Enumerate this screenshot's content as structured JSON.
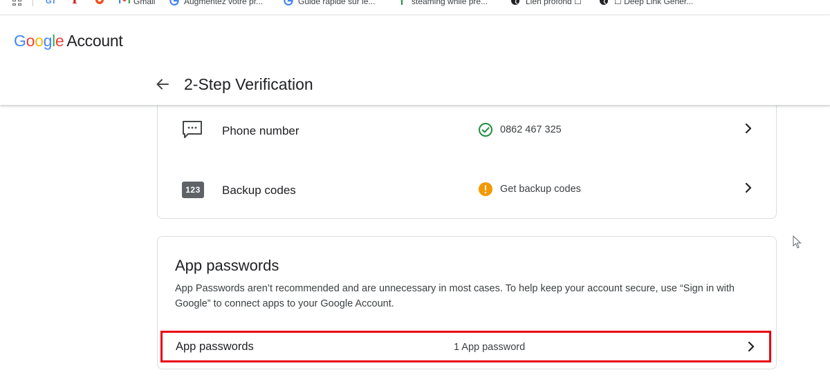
{
  "bookmarks": [
    {
      "icon": "apps-grid-icon",
      "label": ""
    },
    {
      "icon": "gt-icon",
      "label": "GT"
    },
    {
      "icon": "bookmark-red-icon",
      "label": "I"
    },
    {
      "icon": "bookmark-orange-icon",
      "label": ""
    },
    {
      "icon": "gmail-icon",
      "label": "Gmail"
    },
    {
      "icon": "google-icon",
      "label": "Augmentez votre pr..."
    },
    {
      "icon": "google-icon",
      "label": "Guide rapide sur le..."
    },
    {
      "icon": "bookmark-green-icon",
      "label": "steaming while pre..."
    },
    {
      "icon": "globe-icon",
      "label": "Lien profond ☐"
    },
    {
      "icon": "globe-icon",
      "label": "☐ Deep Link Gener..."
    }
  ],
  "header": {
    "logo_g1": "G",
    "logo_g2": "o",
    "logo_g3": "o",
    "logo_g4": "g",
    "logo_g5": "l",
    "logo_g6": "e",
    "logo_account": "Account",
    "page_title": "2-Step Verification"
  },
  "methods": [
    {
      "label": "Phone number",
      "status": "0862 467 325",
      "status_type": "verified",
      "icon": "sms-icon"
    },
    {
      "label": "Backup codes",
      "status": "Get backup codes",
      "status_type": "warning",
      "icon": "backup-codes-icon",
      "badge": "123"
    }
  ],
  "app_passwords": {
    "title": "App passwords",
    "description": "App Passwords aren’t recommended and are unnecessary in most cases. To help keep your account secure, use “Sign in with Google” to connect apps to your Google Account.",
    "row_label": "App passwords",
    "row_value": "1 App password"
  },
  "colors": {
    "accent_blue": "#4285f4",
    "check_green": "#1e8e3e",
    "warning_orange": "#f29900",
    "highlight_red": "#e8000b"
  }
}
